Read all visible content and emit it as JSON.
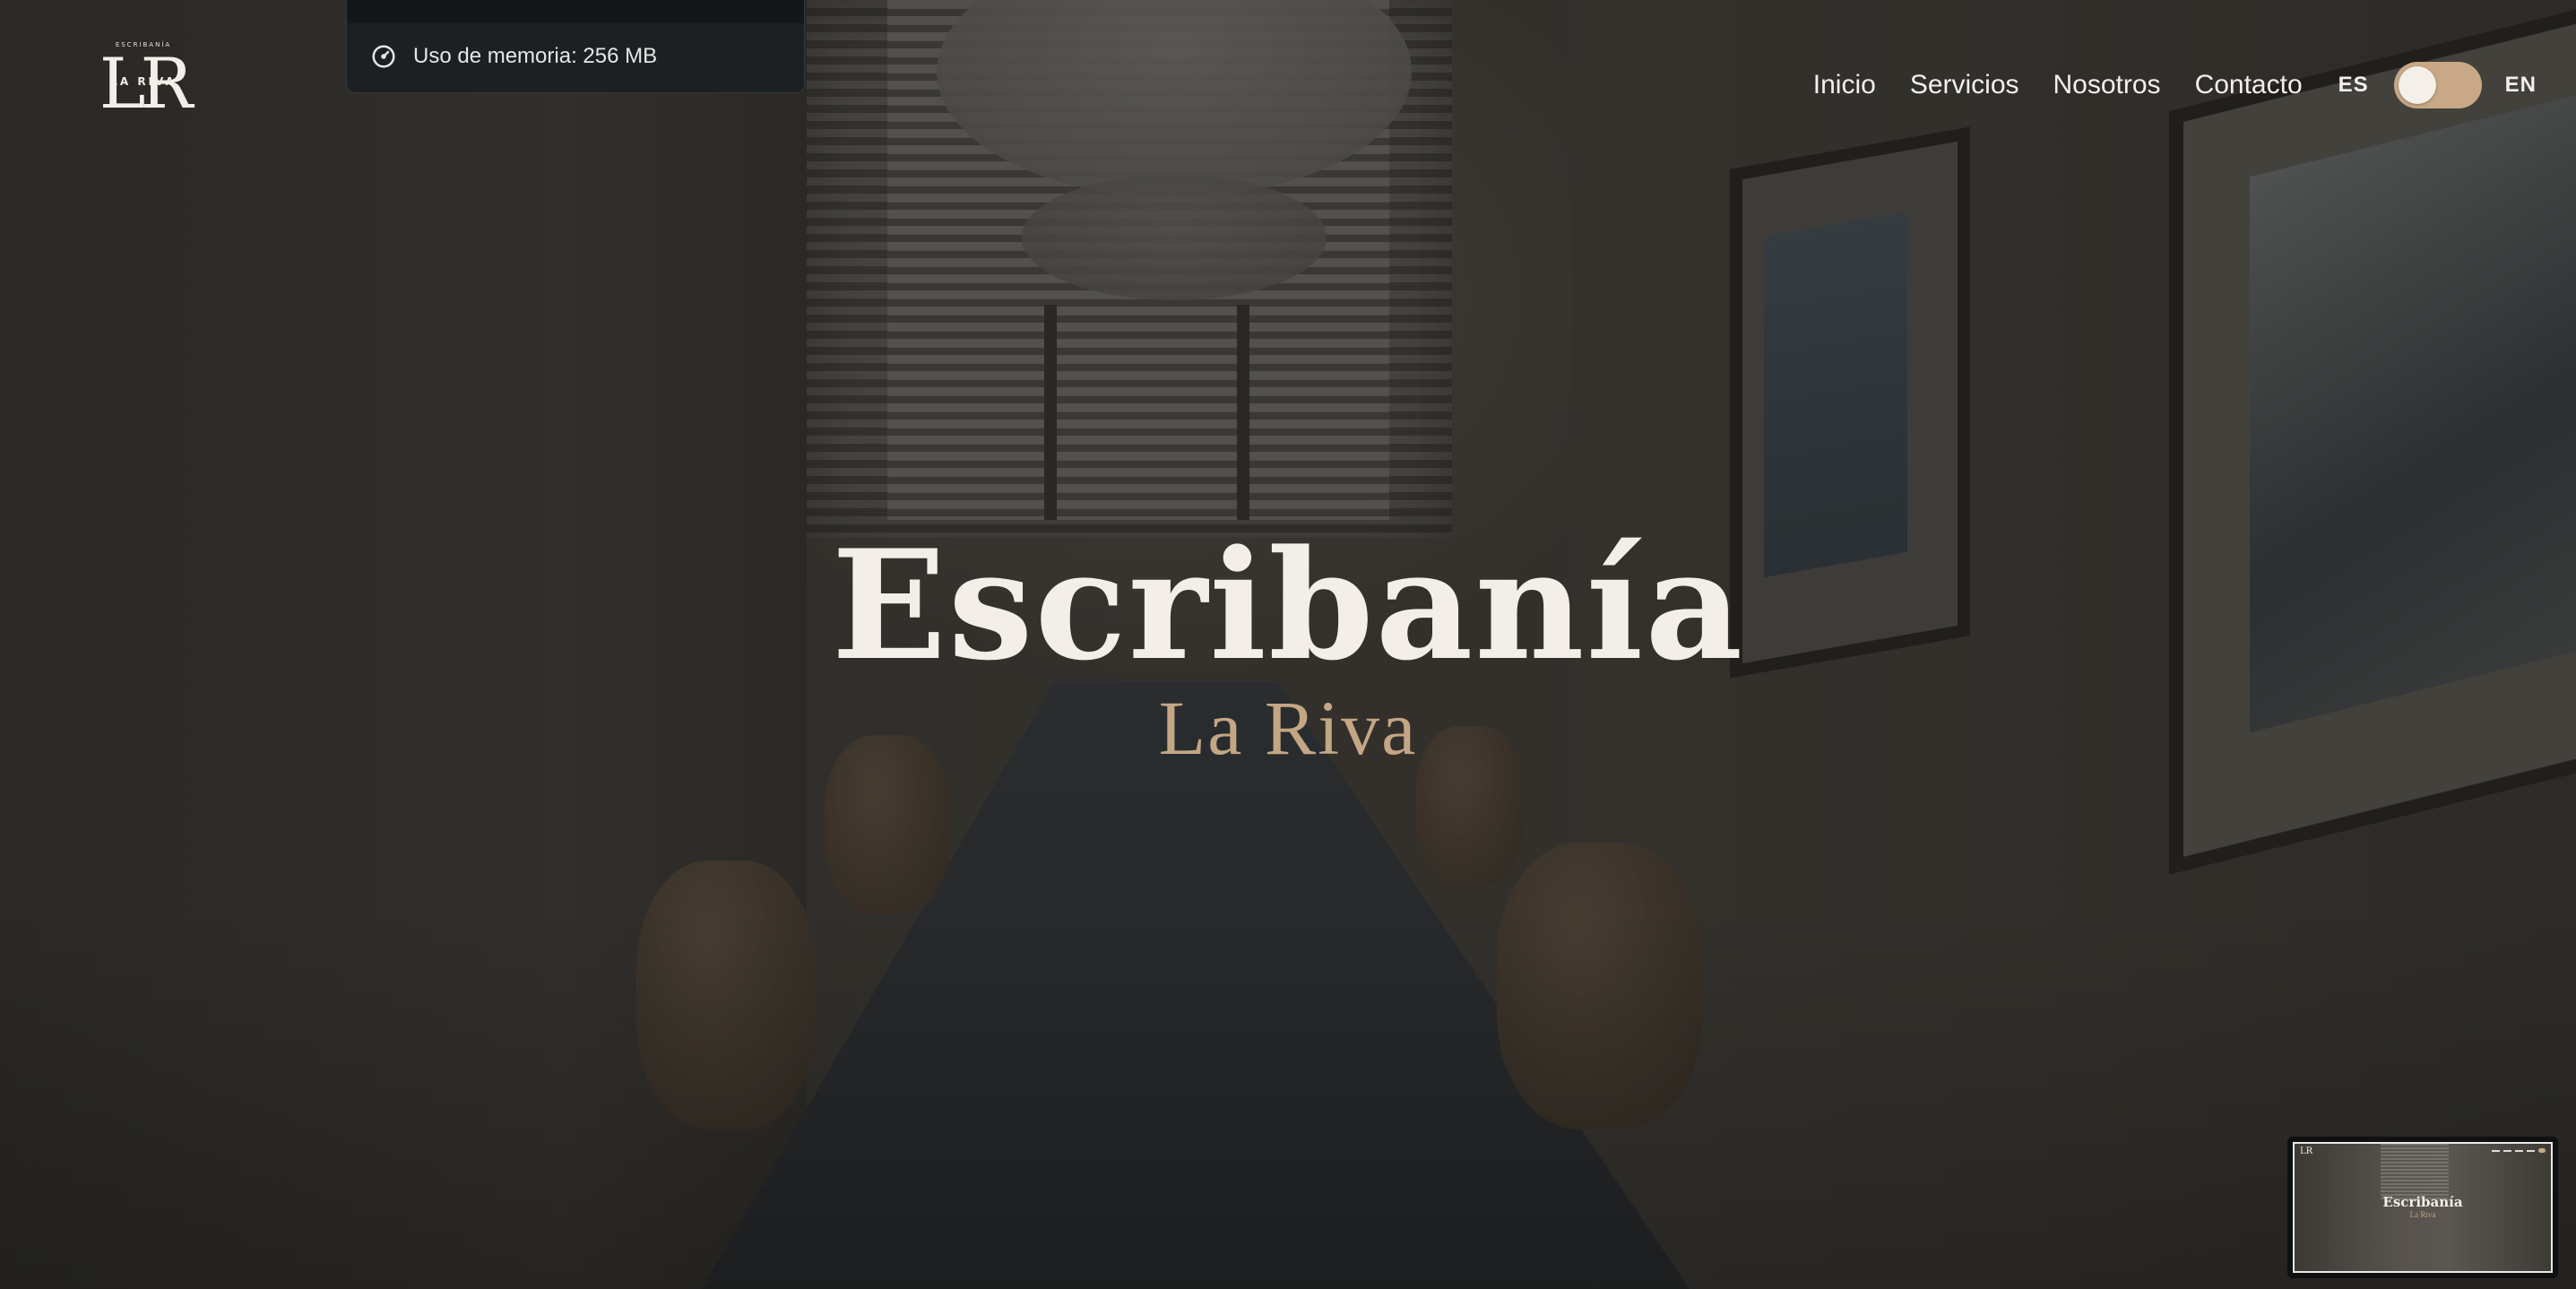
{
  "brand": {
    "logo_small": "ESCRIBANÍA",
    "logo_mark": "LR",
    "logo_sub": "LA RIVA"
  },
  "memory_tooltip": {
    "icon": "gauge-icon",
    "text": "Uso de memoria: 256 MB"
  },
  "nav": {
    "items": [
      {
        "label": "Inicio"
      },
      {
        "label": "Servicios"
      },
      {
        "label": "Nosotros"
      },
      {
        "label": "Contacto"
      }
    ],
    "language": {
      "left": "ES",
      "right": "EN",
      "accent_color": "#c9a887"
    }
  },
  "hero": {
    "title": "Escribanía",
    "subtitle": "La Riva",
    "subtitle_color": "#c4a684"
  },
  "minimap": {
    "logo": "LR",
    "title": "Escribanía",
    "subtitle": "La Riva"
  }
}
